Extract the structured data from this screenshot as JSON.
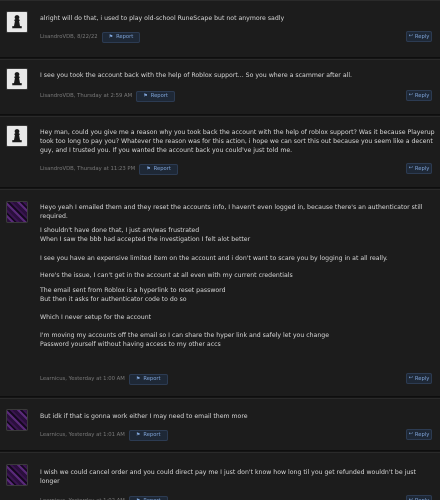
{
  "thread": {
    "posts": [
      {
        "avatar": "chess-piece-avatar",
        "paragraphs": [
          [
            "alright will do that, i used to play old-school RuneScape but not anymore sadly"
          ]
        ],
        "author_date": "LisandroVDB, 8/22/22",
        "report_label": "Report",
        "reply_label": "Reply"
      },
      {
        "avatar": "chess-piece-avatar",
        "paragraphs": [
          [
            "I see you took the account back with the help of Roblox support... So you where a scammer after all."
          ]
        ],
        "author_date": "LisandroVDB, Thursday at 2:59 AM",
        "report_label": "Report",
        "reply_label": "Reply"
      },
      {
        "avatar": "chess-piece-avatar",
        "paragraphs": [
          [
            "Hey man, could you give me a reason why you took back the account with the help of roblox support? Was it because Playerup",
            "took too long to pay you? Whatever the reason was for this action, i hope we can sort this out because you seem like a decent",
            "guy, and I trusted you. If you wanted the account back you could've just told me."
          ]
        ],
        "author_date": "LisandroVDB, Thursday at 11:23 PM",
        "report_label": "Report",
        "reply_label": "Reply"
      },
      {
        "avatar": "purple-pixel-avatar",
        "paragraphs": [
          [
            "Heyo yeah I emailed them and they reset the accounts info, I haven't even logged in, because there's an authenticator still",
            "required."
          ],
          [
            "I shouldn't have done that, I just am/was frustrated",
            "When I saw the bbb had accepted the investigation I felt alot better"
          ],
          [
            "I see you have an expensive limited item on the account and i don't want to scare you by logging in at all really."
          ],
          [
            "Here's the issue, I can't get in the account at all even with my current credentials"
          ],
          [
            "The email sent from Roblox is a hyperlink to reset password",
            "But then it asks for authenticator code to do so"
          ],
          [
            "Which I never setup for the account"
          ],
          [
            "I'm moving my accounts off the email so I can share the hyper link and safely let you change",
            "Password yourself without having access to my other accs"
          ]
        ],
        "author_date": "Learnicus, Yesterday at 1:00 AM",
        "report_label": "Report",
        "reply_label": "Reply"
      },
      {
        "avatar": "purple-pixel-avatar",
        "paragraphs": [
          [
            "But idk if that is gonna work either I may need to email them more"
          ]
        ],
        "author_date": "Learnicus, Yesterday at 1:01 AM",
        "report_label": "Report",
        "reply_label": "Reply"
      },
      {
        "avatar": "purple-pixel-avatar",
        "paragraphs": [
          [
            "I wish we could cancel order and you could direct pay me I just don't know how long til you get refunded wouldn't be just",
            "longer"
          ]
        ],
        "author_date": "Learnicus, Yesterday at 1:02 AM",
        "report_label": "Report",
        "reply_label": "Reply"
      }
    ]
  }
}
